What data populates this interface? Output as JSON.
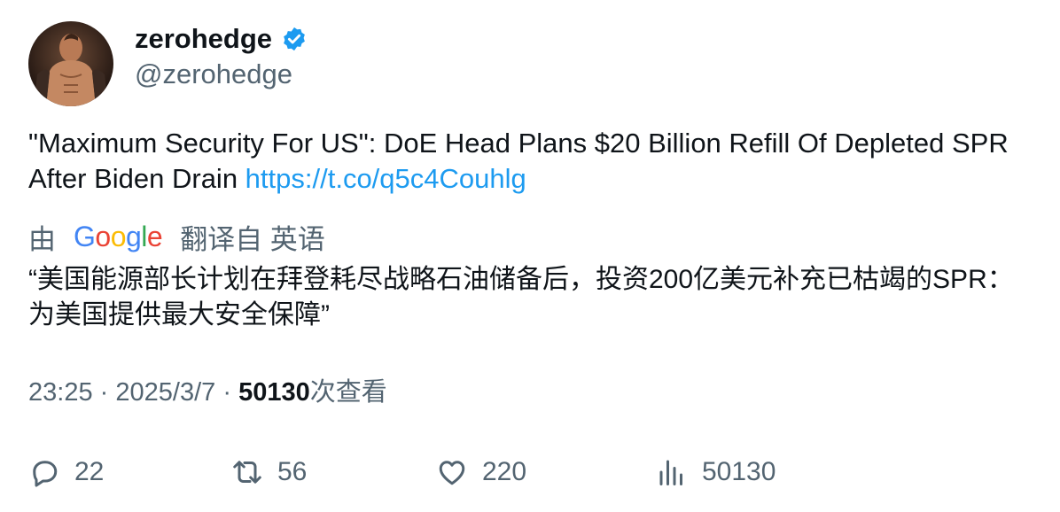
{
  "author": {
    "display_name": "zerohedge",
    "handle": "@zerohedge",
    "verified": true,
    "verified_color": "#1d9bf0"
  },
  "tweet": {
    "text": "\"Maximum Security For US\": DoE Head Plans $20 Billion Refill Of Depleted SPR After Biden Drain ",
    "link": "https://t.co/q5c4Couhlg",
    "link_color": "#1d9bf0"
  },
  "translation": {
    "prefix": "由",
    "provider": "Google",
    "suffix": "翻译自 英语",
    "text": "“美国能源部长计划在拜登耗尽战略石油储备后，投资200亿美元补充已枯竭的SPR：为美国提供最大安全保障”"
  },
  "meta": {
    "time": "23:25",
    "date": "2025/3/7",
    "separator": "·",
    "views_count": "50130",
    "views_label": "次查看"
  },
  "actions": {
    "reply_count": "22",
    "retweet_count": "56",
    "like_count": "220",
    "views_count": "50130"
  },
  "icons": {
    "reply": "reply-icon",
    "retweet": "retweet-icon",
    "like": "heart-icon",
    "views": "views-chart-icon",
    "verified": "verified-badge-icon"
  }
}
